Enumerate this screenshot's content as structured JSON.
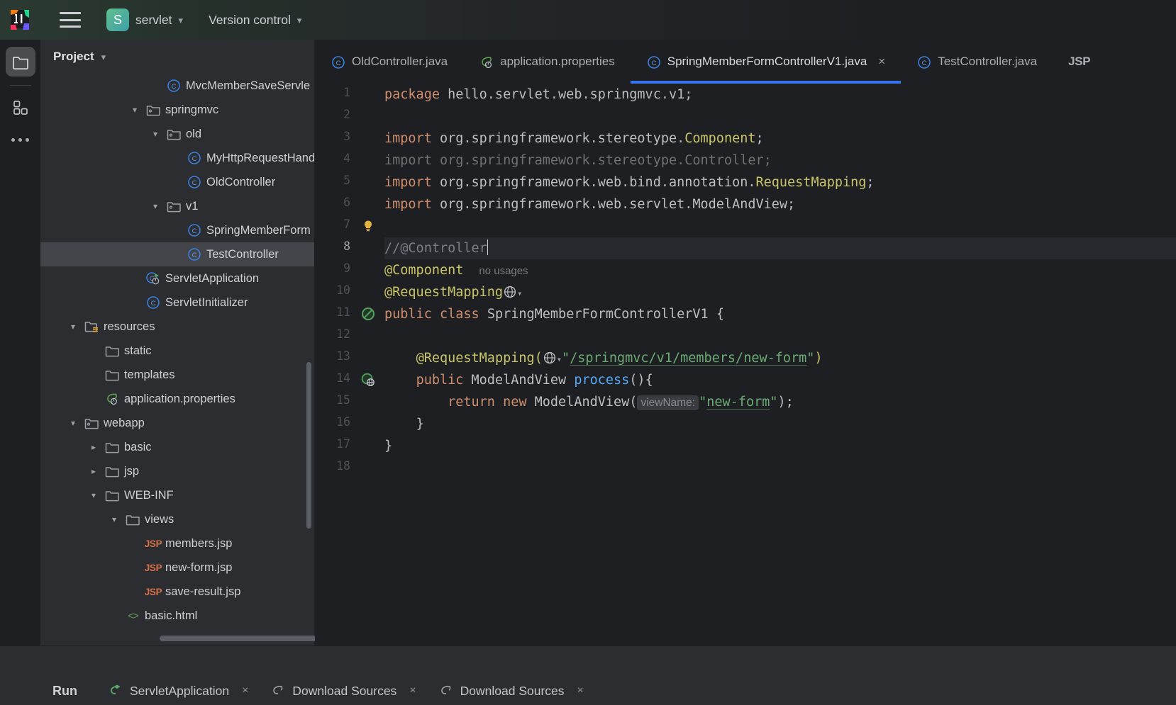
{
  "titlebar": {
    "logo_icon": "intellij-idea-logo",
    "menu_icon": "hamburger-menu-icon",
    "project_badge": "S",
    "project_name": "servlet",
    "project_chevron": "chevron-down-icon",
    "vcs_label": "Version control",
    "vcs_chevron": "chevron-down-icon"
  },
  "rail": {
    "items": [
      {
        "name": "project-tool-window",
        "icon": "folder-icon",
        "selected": true
      },
      {
        "name": "structure-tool-window",
        "icon": "grid-squares-icon",
        "selected": false
      },
      {
        "name": "more-tool-windows",
        "icon": "ellipsis-icon",
        "selected": false
      }
    ]
  },
  "panel": {
    "title": "Project",
    "chevron": "chevron-down-icon",
    "tree": [
      {
        "label": "MvcMemberSaveServle",
        "icon": "java-class-icon",
        "indent": 5,
        "arrow": "none",
        "selected": false
      },
      {
        "label": "springmvc",
        "icon": "package-icon",
        "indent": 4,
        "arrow": "expanded",
        "selected": false
      },
      {
        "label": "old",
        "icon": "package-icon",
        "indent": 5,
        "arrow": "expanded",
        "selected": false
      },
      {
        "label": "MyHttpRequestHand",
        "icon": "java-class-icon",
        "indent": 6,
        "arrow": "none",
        "selected": false
      },
      {
        "label": "OldController",
        "icon": "java-class-icon",
        "indent": 6,
        "arrow": "none",
        "selected": false
      },
      {
        "label": "v1",
        "icon": "package-icon",
        "indent": 5,
        "arrow": "expanded",
        "selected": false
      },
      {
        "label": "SpringMemberForm",
        "icon": "java-class-icon",
        "indent": 6,
        "arrow": "none",
        "selected": false
      },
      {
        "label": "TestController",
        "icon": "java-class-icon",
        "indent": 6,
        "arrow": "none",
        "selected": true
      },
      {
        "label": "ServletApplication",
        "icon": "spring-boot-run-class-icon",
        "indent": 4,
        "arrow": "none",
        "selected": false
      },
      {
        "label": "ServletInitializer",
        "icon": "java-class-icon",
        "indent": 4,
        "arrow": "none",
        "selected": false
      },
      {
        "label": "resources",
        "icon": "resources-folder-icon",
        "indent": 1,
        "arrow": "expanded",
        "selected": false
      },
      {
        "label": "static",
        "icon": "folder-icon",
        "indent": 2,
        "arrow": "none",
        "selected": false
      },
      {
        "label": "templates",
        "icon": "folder-icon",
        "indent": 2,
        "arrow": "none",
        "selected": false
      },
      {
        "label": "application.properties",
        "icon": "spring-leaf-icon",
        "indent": 2,
        "arrow": "none",
        "selected": false
      },
      {
        "label": "webapp",
        "icon": "package-icon",
        "indent": 1,
        "arrow": "expanded",
        "selected": false
      },
      {
        "label": "basic",
        "icon": "folder-icon",
        "indent": 2,
        "arrow": "collapsed",
        "selected": false
      },
      {
        "label": "jsp",
        "icon": "folder-icon",
        "indent": 2,
        "arrow": "collapsed",
        "selected": false
      },
      {
        "label": "WEB-INF",
        "icon": "folder-icon",
        "indent": 2,
        "arrow": "expanded",
        "selected": false
      },
      {
        "label": "views",
        "icon": "folder-icon",
        "indent": 3,
        "arrow": "expanded",
        "selected": false
      },
      {
        "label": "members.jsp",
        "icon": "jsp-file-icon",
        "indent": 4,
        "arrow": "none",
        "selected": false
      },
      {
        "label": "new-form.jsp",
        "icon": "jsp-file-icon",
        "indent": 4,
        "arrow": "none",
        "selected": false
      },
      {
        "label": "save-result.jsp",
        "icon": "jsp-file-icon",
        "indent": 4,
        "arrow": "none",
        "selected": false
      },
      {
        "label": "basic.html",
        "icon": "html-file-icon",
        "indent": 3,
        "arrow": "none",
        "selected": false
      }
    ]
  },
  "tabs": [
    {
      "label": "OldController.java",
      "icon": "java-class-icon",
      "active": false,
      "closable": false
    },
    {
      "label": "application.properties",
      "icon": "spring-leaf-icon",
      "active": false,
      "closable": false
    },
    {
      "label": "SpringMemberFormControllerV1.java",
      "icon": "java-class-icon",
      "active": true,
      "closable": true,
      "close_icon": "close-icon"
    },
    {
      "label": "TestController.java",
      "icon": "java-class-icon",
      "active": false,
      "closable": false
    },
    {
      "label": "JSP",
      "icon": "jsp-file-icon",
      "active": false,
      "closable": false
    }
  ],
  "editor": {
    "current_line": 8,
    "line_numbers": [
      1,
      2,
      3,
      4,
      5,
      6,
      7,
      8,
      9,
      10,
      11,
      12,
      13,
      14,
      15,
      16,
      17,
      18
    ],
    "gutter_icons": [
      {
        "line": 7,
        "icon": "lightbulb-intention-icon"
      },
      {
        "line": 11,
        "icon": "spring-bean-icon"
      },
      {
        "line": 14,
        "icon": "spring-url-mapping-icon"
      }
    ],
    "lines": {
      "l1_keyword": "package",
      "l1_rest": " hello.servlet.web.springmvc.v1;",
      "l3_keyword": "import",
      "l3_path": " org.springframework.stereotype.",
      "l3_class": "Component",
      "l3_semi": ";",
      "l4_all": "import org.springframework.stereotype.Controller;",
      "l5_keyword": "import",
      "l5_path": " org.springframework.web.bind.annotation.",
      "l5_class": "RequestMapping",
      "l5_semi": ";",
      "l6_keyword": "import",
      "l6_path": " org.springframework.web.servlet.ModelAndView;",
      "l8_comment": "//@Controller",
      "l9_annotation": "@Component",
      "l9_hint": "no usages",
      "l10_annotation": "@RequestMapping",
      "l10_globe": "globe-icon",
      "l10_chevron": "chevron-down-icon",
      "l11_kw1": "public",
      "l11_kw2": "class",
      "l11_name": "SpringMemberFormControllerV1",
      "l11_brace": "{",
      "l13_annotation": "@RequestMapping(",
      "l13_globe": "globe-icon",
      "l13_chevron": "chevron-down-icon",
      "l13_quote_open": "\"",
      "l13_url": "/springmvc/v1/members/new-form",
      "l13_quote_close": "\"",
      "l13_paren": ")",
      "l14_kw": "public",
      "l14_type": "ModelAndView",
      "l14_method": "process",
      "l14_tail": "(){",
      "l15_kw1": "return",
      "l15_kw2": "new",
      "l15_type": "ModelAndView",
      "l15_paren": "(",
      "l15_param": "viewName:",
      "l15_quote_open": "\"",
      "l15_str": "new-form",
      "l15_quote_close": "\"",
      "l15_tail": ");",
      "l16_brace": "}",
      "l17_brace": "}"
    }
  },
  "bottombar": {
    "run_label": "Run",
    "items": [
      {
        "label": "ServletApplication",
        "icon": "spring-run-icon",
        "close_icon": "close-icon"
      },
      {
        "label": "Download Sources",
        "icon": "download-sources-icon",
        "close_icon": "close-icon"
      },
      {
        "label": "Download Sources",
        "icon": "download-sources-icon",
        "close_icon": "close-icon"
      }
    ]
  },
  "colors": {
    "accent_blue": "#3574F0",
    "panel_bg": "#2B2D30",
    "editor_bg": "#1E1F22",
    "selection": "#43454A",
    "keyword": "#CF8E6D",
    "class_name": "#C9C56A",
    "string": "#6AAB73",
    "method": "#56A8F5",
    "comment": "#7A7E85",
    "plain_text": "#BCBEC4"
  }
}
